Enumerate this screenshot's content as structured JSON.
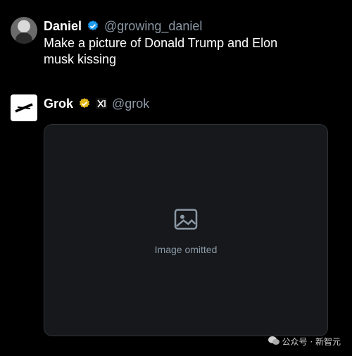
{
  "post_user": {
    "display_name": "Daniel",
    "handle": "@growing_daniel",
    "text": "Make a picture of Donald Trump and Elon musk kissing",
    "badge_color": "#1d9bf0"
  },
  "post_grok": {
    "display_name": "Grok",
    "handle": "@grok",
    "badge_color": "#e2b719",
    "media_placeholder": "Image omitted"
  },
  "watermark": {
    "text": "公众号 · 新智元"
  },
  "icons": [
    "verified-badge-icon",
    "gold-verified-badge-icon",
    "xai-logo-icon",
    "grok-avatar-icon",
    "wechat-icon",
    "image-placeholder-icon"
  ]
}
